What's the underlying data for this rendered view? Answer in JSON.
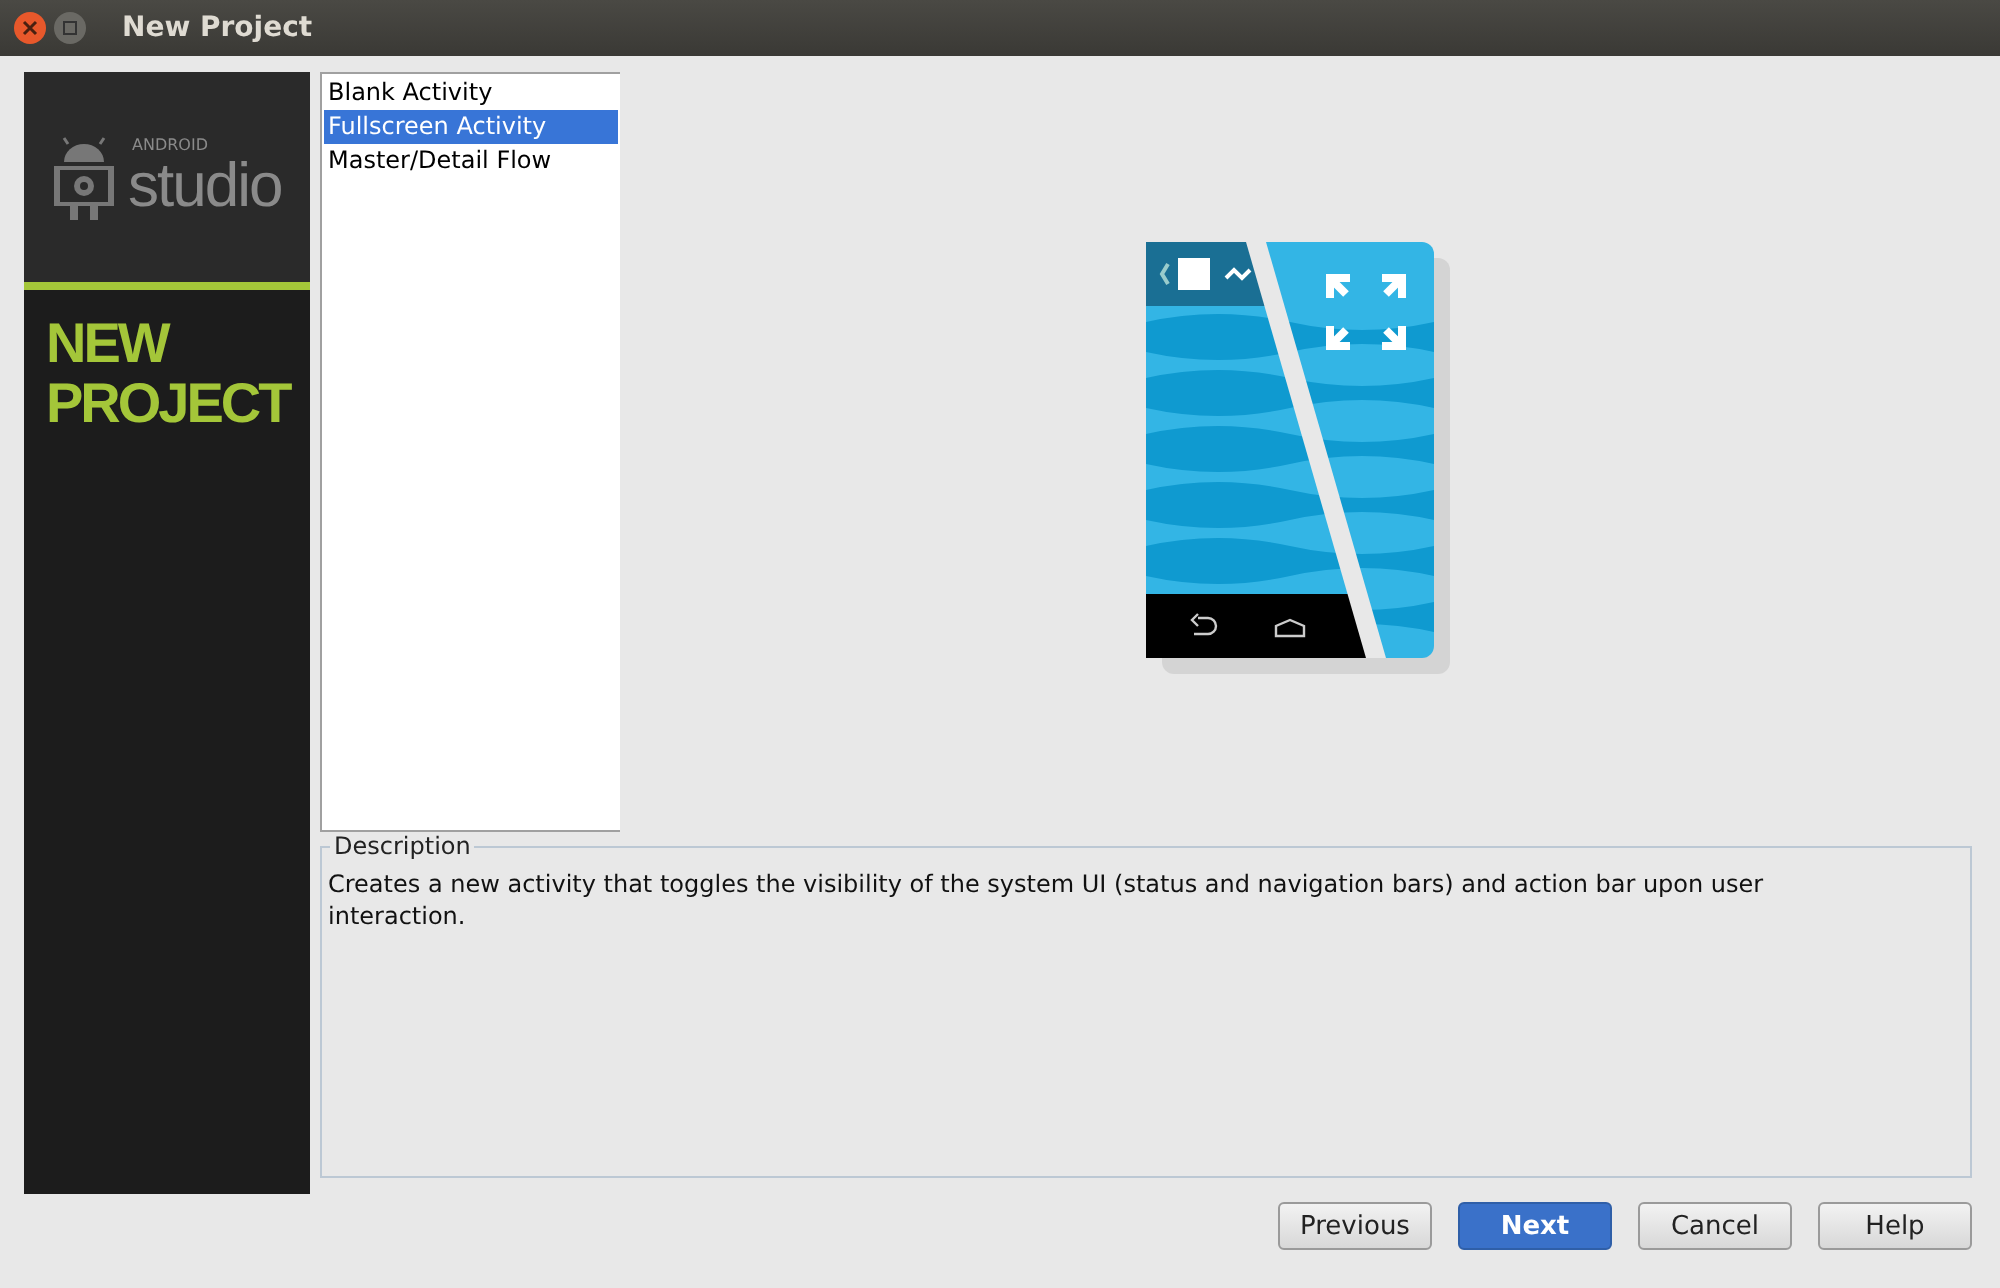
{
  "window": {
    "title": "New Project"
  },
  "banner": {
    "brand_small": "ANDROID",
    "brand": "studio",
    "heading": [
      "NEW",
      "PROJECT"
    ]
  },
  "templates": [
    {
      "label": "Blank Activity",
      "selected": false
    },
    {
      "label": "Fullscreen Activity",
      "selected": true
    },
    {
      "label": "Master/Detail Flow",
      "selected": false
    }
  ],
  "description": {
    "title": "Description",
    "text": "Creates a new activity that toggles the visibility of the system UI (status and navigation bars) and action bar upon user interaction."
  },
  "buttons": [
    {
      "label": "Previous",
      "kind": "normal"
    },
    {
      "label": "Next",
      "kind": "default"
    },
    {
      "label": "Cancel",
      "kind": "normal"
    },
    {
      "label": "Help",
      "kind": "normal"
    }
  ]
}
